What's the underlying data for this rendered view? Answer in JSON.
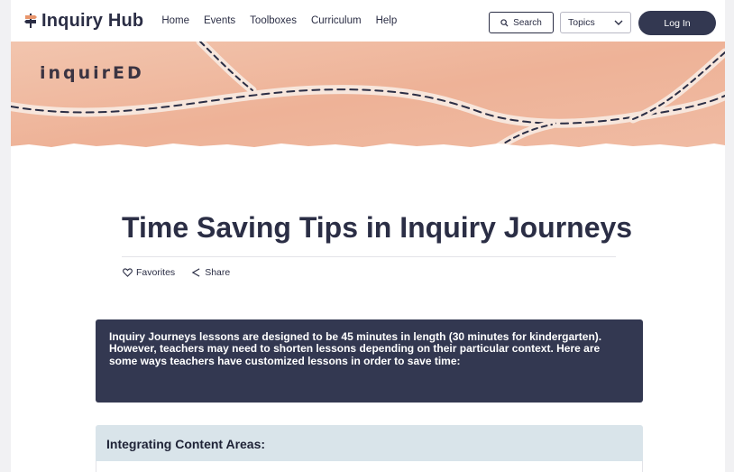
{
  "brand": {
    "name": "Inquiry Hub",
    "icon": "signpost-icon"
  },
  "nav": {
    "items": [
      "Home",
      "Events",
      "Toolboxes",
      "Curriculum",
      "Help"
    ]
  },
  "search": {
    "label": "Search",
    "icon": "search-icon"
  },
  "topics": {
    "selected": "Topics",
    "icon": "chevron-down-icon"
  },
  "login": {
    "label": "Log In"
  },
  "hero": {
    "logo_text": "inquirED"
  },
  "article": {
    "title": "Time Saving Tips in Inquiry Journeys",
    "favorites_label": "Favorites",
    "share_label": "Share",
    "intro": "Inquiry Journeys lessons are designed to be 45 minutes in length (30 minutes for kindergarten). However, teachers may need to shorten lessons depending on their particular context. Here are some ways teachers have customized lessons in order to save time:",
    "section_heading": "Integrating Content Areas:"
  },
  "colors": {
    "navy": "#333851",
    "hero_peach": "#eeb49a",
    "section_header": "#d9e4ea",
    "background": "#f1f1f3"
  }
}
